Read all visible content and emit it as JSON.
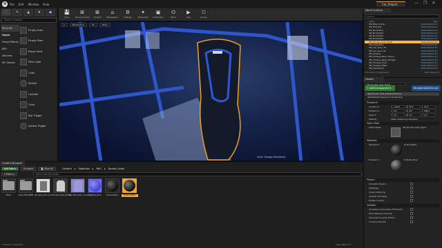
{
  "title": {
    "menus": [
      "File",
      "Edit",
      "Window",
      "Help"
    ],
    "project": "Car_Project",
    "win_controls": [
      "—",
      "❐",
      "✕"
    ]
  },
  "modes": {
    "search_placeholder": "Search Classes",
    "categories": [
      "Recently Placed",
      "Lights",
      "Visual Effects",
      "BSP",
      "Volumes",
      "All Classes"
    ],
    "items": [
      "Empty Actor",
      "Empty Pawn",
      "Player Start",
      "Point Light",
      "Cube",
      "Sphere",
      "Cylinder",
      "Cone",
      "Box Trigger",
      "Sphere Trigger"
    ]
  },
  "toolbar": {
    "items": [
      {
        "icon": "💾",
        "label": "Save"
      },
      {
        "icon": "⊞",
        "label": "Source Control"
      },
      {
        "icon": "⊠",
        "label": "Content"
      },
      {
        "icon": "⌂",
        "label": "Marketplace"
      },
      {
        "icon": "⚙",
        "label": "Settings"
      },
      {
        "icon": "✦",
        "label": "Blueprints"
      },
      {
        "icon": "▣",
        "label": "Cinematics"
      },
      {
        "icon": "⌬",
        "label": "Build"
      },
      {
        "icon": "▶",
        "label": "Play"
      },
      {
        "icon": "⎋",
        "label": "Launch"
      }
    ]
  },
  "viewport": {
    "options": [
      "▾",
      "Perspective",
      "Lit",
      "Show"
    ],
    "label": "Level: Garage (Persistent)"
  },
  "outliner": {
    "tab": "World Outliner",
    "search_placeholder": "Search...",
    "col_label": "Label",
    "col_type": "Type",
    "rows": [
      {
        "label": "SM_Bike_Frame",
        "type": "StaticMeshActor"
      },
      {
        "label": "SM_Bolt_Set",
        "type": "StaticMeshActor"
      },
      {
        "label": "SM_Bodykit01",
        "type": "StaticMeshActor"
      },
      {
        "label": "SM_Bodykit02",
        "type": "StaticMeshActor"
      },
      {
        "label": "SM_Bodykit03",
        "type": "StaticMeshActor"
      },
      {
        "label": "SM_Bodykit04",
        "type": "StaticMeshActor"
      },
      {
        "label": "SM_Bucket_Seat_Right",
        "type": "StaticMeshActor",
        "selected": true
      },
      {
        "label": "SM_Cage_Bars",
        "type": "StaticMeshActor"
      },
      {
        "label": "SM_Car_Door_FR",
        "type": "StaticMeshActor"
      },
      {
        "label": "SM_Car_Door_RL",
        "type": "StaticMeshActor"
      },
      {
        "label": "SM_Chassis",
        "type": "StaticMeshActor"
      },
      {
        "label": "SM_Chassis_Back_Frame",
        "type": "StaticMeshActor"
      },
      {
        "label": "SM_Chassis_Back_Bumper",
        "type": "StaticMeshActor"
      },
      {
        "label": "SM_Chassis_Front",
        "type": "StaticMeshActor"
      },
      {
        "label": "SM_Chassis_Plate",
        "type": "StaticMeshActor"
      },
      {
        "label": "SM_Dashboard",
        "type": "StaticMeshActor"
      }
    ],
    "footer_left": "175 actors (1 selected)",
    "footer_right": "View Options ▾"
  },
  "details": {
    "tab": "Details",
    "name": "SM_Bucket_Seat_Right",
    "add_component": "+ Add Component ▾",
    "blueprint_script": "Blueprint/Add Script",
    "components": [
      "SM_Bucket_Seat_Right(Instance)",
      "StaticMeshComponent (Inherited)"
    ],
    "sections": {
      "transform": "Transform",
      "static_mesh": "Static Mesh",
      "materials": "Materials",
      "physics": "Physics",
      "collision": "Collision"
    },
    "transform": {
      "location": {
        "label": "Location ▾",
        "x": "-120.0",
        "y": "33.5",
        "z": "12.0"
      },
      "rotation": {
        "label": "Rotation ▾",
        "x": "0.0",
        "y": "0.0",
        "z": "180.0"
      },
      "scale": {
        "label": "Scale ▾",
        "x": "1.0",
        "y": "1.0",
        "z": "1.0"
      },
      "mobility": {
        "label": "Mobility",
        "value": "Static  Stationary  Movable"
      }
    },
    "static_mesh_label": "Static Mesh",
    "static_mesh_value": "SM_Bucket_Seat_Right",
    "element0": "Element 0",
    "element0_value": "M_Bucket02",
    "element1": "Element 1",
    "element1_value": "M_Belts_Blue",
    "physics_props": [
      "Simulate Physics",
      "MassInKg",
      "Linear Damping",
      "Angular Damping",
      "Enable Gravity"
    ],
    "collision_props": [
      "Simulation Generates Hit Events",
      "Phys Material Override",
      "Generate Overlap Events",
      "Collision Presets"
    ]
  },
  "content_browser": {
    "tab": "Content Browser",
    "add_new": "Add New ▾",
    "import": "⬆ Import",
    "save_all": "💾 Save All",
    "breadcrumbs": [
      "Content",
      "Materials",
      "MK1",
      "Bucket_Seats"
    ],
    "filters": "▾ Filters ▾",
    "search_placeholder": "Search Bucket_Seats",
    "assets": [
      {
        "name": "Mesh",
        "kind": "folder"
      },
      {
        "name": "OLD_TEXTURES",
        "kind": "folder"
      },
      {
        "name": "Bucket_Seat_Sub",
        "kind": "texture"
      },
      {
        "name": "Bucket_Seat_Detail",
        "kind": "texture2"
      },
      {
        "name": "Bucket_Seat_normal_1",
        "kind": "texture3"
      },
      {
        "name": "M_Belts_Blue",
        "kind": "sphere-blue"
      },
      {
        "name": "M_Bucket01",
        "kind": "sphere-dark"
      },
      {
        "name": "M_Bucket02",
        "kind": "sphere-sel",
        "selected": true
      }
    ],
    "status": "8 items (1 selected)",
    "view_options": "View Options ▾"
  }
}
